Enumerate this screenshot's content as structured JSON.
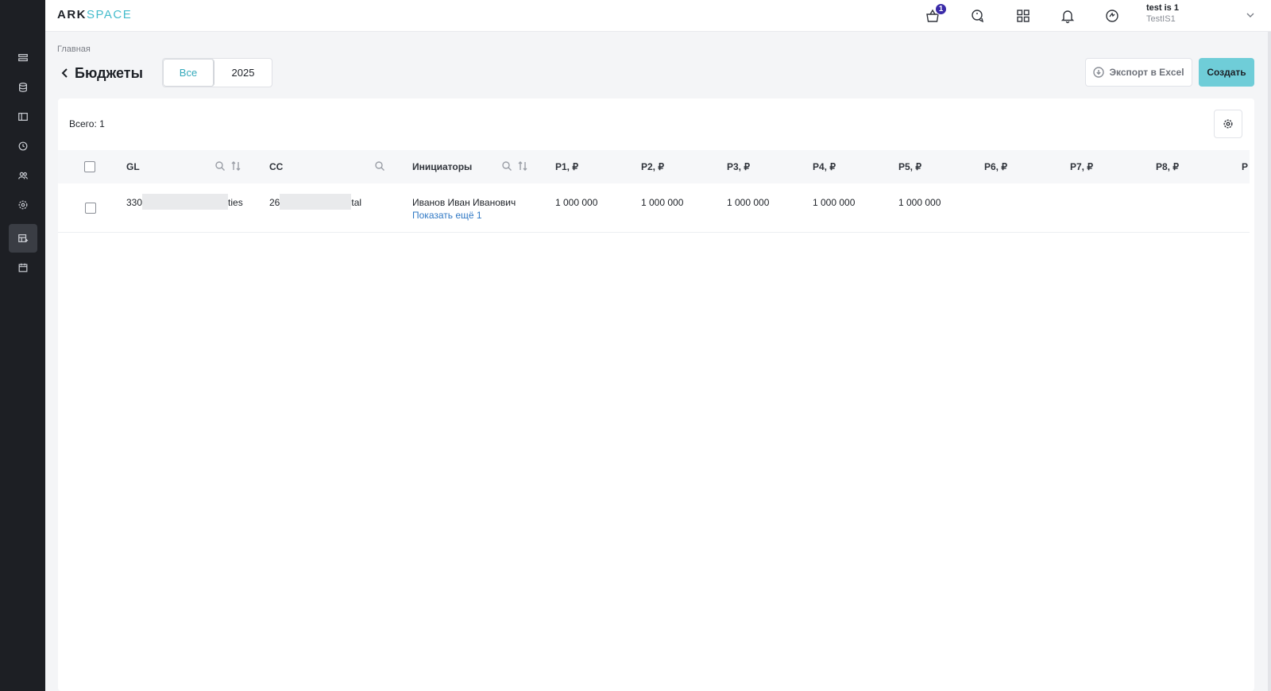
{
  "brand": {
    "part1": "ARK",
    "part2": "SPACE",
    "accent": "#45bccc"
  },
  "topbar": {
    "cart_badge": "1",
    "user": {
      "name": "test is 1",
      "org": "TestIS1"
    }
  },
  "sidebar": {
    "items": [
      {
        "icon": "list-icon"
      },
      {
        "icon": "database-icon"
      },
      {
        "icon": "layout-icon"
      },
      {
        "icon": "clock-icon"
      },
      {
        "icon": "users-icon"
      },
      {
        "icon": "gear-icon"
      },
      {
        "icon": "budget-icon",
        "active": true
      },
      {
        "icon": "calendar-icon"
      }
    ]
  },
  "page": {
    "breadcrumb": "Главная",
    "title": "Бюджеты",
    "filters": [
      "Все",
      "2025"
    ],
    "selected_filter": "Все",
    "export_label": "Экспорт в Excel",
    "create_label": "Создать",
    "total": "Всего: 1"
  },
  "table": {
    "columns": [
      "GL",
      "CC",
      "Инициаторы",
      "P1, ₽",
      "P2, ₽",
      "P3, ₽",
      "P4, ₽",
      "P5, ₽",
      "P6, ₽",
      "P7, ₽",
      "P8, ₽",
      "P"
    ],
    "rows": [
      {
        "gl_start": "330",
        "gl_end": "ties",
        "cc_start": "26",
        "cc_end": "tal",
        "initiator": "Иванов Иван Иванович",
        "show_more": "Показать ещё 1",
        "p1": "1 000 000",
        "p2": "1 000 000",
        "p3": "1 000 000",
        "p4": "1 000 000",
        "p5": "1 000 000"
      }
    ]
  }
}
